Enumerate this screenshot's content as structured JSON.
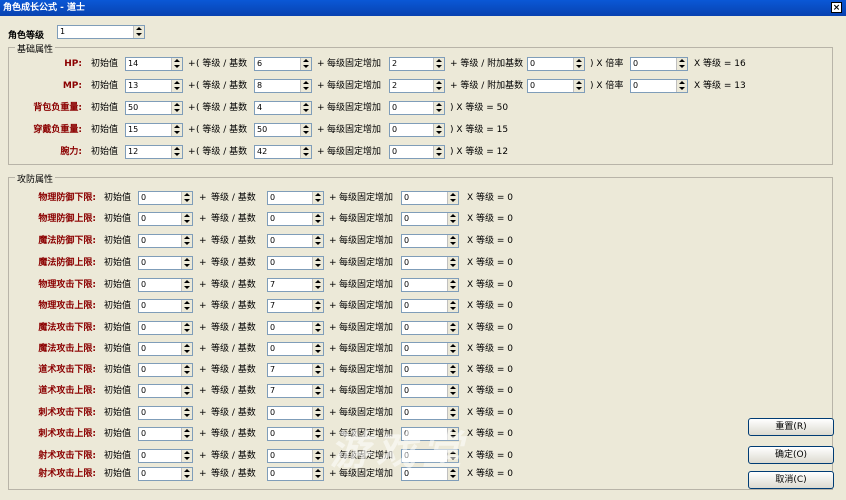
{
  "window": {
    "title": "角色成长公式 - 道士",
    "close_icon": "close-icon"
  },
  "level": {
    "label": "角色等级",
    "value": "1"
  },
  "basic": {
    "title": "基础属性",
    "rows": [
      {
        "label": "HP:",
        "initial_label": "初始值",
        "initial": "14",
        "plus1": "+",
        "per_label": "( 等级 / 基数",
        "per": "6",
        "plus2": "+",
        "fixed_label": "每级固定增加",
        "fixed": "2",
        "extra_label": "+ 等级 / 附加基数",
        "extra": "0",
        "mult_label": ") X 倍率",
        "mult": "0",
        "result": "X 等级 = 16"
      },
      {
        "label": "MP:",
        "initial_label": "初始值",
        "initial": "13",
        "plus1": "+",
        "per_label": "( 等级 / 基数",
        "per": "8",
        "plus2": "+",
        "fixed_label": "每级固定增加",
        "fixed": "2",
        "extra_label": "+ 等级 / 附加基数",
        "extra": "0",
        "mult_label": ") X 倍率",
        "mult": "0",
        "result": "X 等级 = 13"
      },
      {
        "label": "背包负重量:",
        "initial_label": "初始值",
        "initial": "50",
        "plus1": "+",
        "per_label": "( 等级 / 基数",
        "per": "4",
        "plus2": "+",
        "fixed_label": "每级固定增加",
        "fixed": "0",
        "result": ") X 等级 = 50"
      },
      {
        "label": "穿戴负重量:",
        "initial_label": "初始值",
        "initial": "15",
        "plus1": "+",
        "per_label": "( 等级 / 基数",
        "per": "50",
        "plus2": "+",
        "fixed_label": "每级固定增加",
        "fixed": "0",
        "result": ") X 等级 = 15"
      },
      {
        "label": "腕力:",
        "initial_label": "初始值",
        "initial": "12",
        "plus1": "+",
        "per_label": "( 等级 / 基数",
        "per": "42",
        "plus2": "+",
        "fixed_label": "每级固定增加",
        "fixed": "0",
        "result": ") X 等级 = 12"
      }
    ]
  },
  "attack": {
    "title": "攻防属性",
    "rows": [
      {
        "label": "物理防御下限:",
        "initial": "0",
        "per": "0",
        "fixed": "0",
        "result": "X 等级 = 0"
      },
      {
        "label": "物理防御上限:",
        "initial": "0",
        "per": "0",
        "fixed": "0",
        "result": "X 等级 = 0"
      },
      {
        "label": "魔法防御下限:",
        "initial": "0",
        "per": "0",
        "fixed": "0",
        "result": "X 等级 = 0"
      },
      {
        "label": "魔法防御上限:",
        "initial": "0",
        "per": "0",
        "fixed": "0",
        "result": "X 等级 = 0"
      },
      {
        "label": "物理攻击下限:",
        "initial": "0",
        "per": "7",
        "fixed": "0",
        "result": "X 等级 = 0"
      },
      {
        "label": "物理攻击上限:",
        "initial": "0",
        "per": "7",
        "fixed": "0",
        "result": "X 等级 = 0"
      },
      {
        "label": "魔法攻击下限:",
        "initial": "0",
        "per": "0",
        "fixed": "0",
        "result": "X 等级 = 0"
      },
      {
        "label": "魔法攻击上限:",
        "initial": "0",
        "per": "0",
        "fixed": "0",
        "result": "X 等级 = 0"
      },
      {
        "label": "道术攻击下限:",
        "initial": "0",
        "per": "7",
        "fixed": "0",
        "result": "X 等级 = 0"
      },
      {
        "label": "道术攻击上限:",
        "initial": "0",
        "per": "7",
        "fixed": "0",
        "result": "X 等级 = 0"
      },
      {
        "label": "刺术攻击下限:",
        "initial": "0",
        "per": "0",
        "fixed": "0",
        "result": "X 等级 = 0"
      },
      {
        "label": "刺术攻击上限:",
        "initial": "0",
        "per": "0",
        "fixed": "0",
        "result": "X 等级 = 0"
      },
      {
        "label": "射术攻击下限:",
        "initial": "0",
        "per": "0",
        "fixed": "0",
        "result": "X 等级 = 0"
      },
      {
        "label": "射术攻击上限:",
        "initial": "0",
        "per": "0",
        "fixed": "0",
        "result": "X 等级 = 0"
      }
    ],
    "initial_label": "初始值",
    "plus1": "+",
    "per_label": "等级 / 基数",
    "plus2": "+",
    "fixed_label": "每级固定增加"
  },
  "buttons": {
    "reset": "重置(R)",
    "ok": "确定(O)",
    "cancel": "取消(C)"
  },
  "watermark": "游戏堂"
}
